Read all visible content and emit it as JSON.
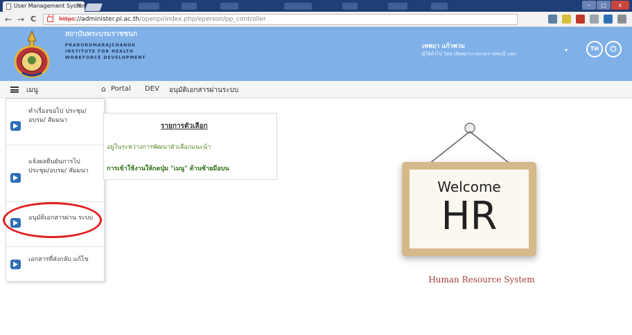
{
  "browser": {
    "tab_title": "User Management System",
    "tab_close": "×",
    "nav_back": "←",
    "nav_forward": "→",
    "nav_reload": "C",
    "url_scheme": "https",
    "url_host": "://administer.pi.ac.th",
    "url_path": "/openpi/index.php/eperson/pp_controller",
    "window_min": "–",
    "window_max": "□",
    "window_close": "x",
    "ext_colors": [
      "#5a7fa0",
      "#d8c03a",
      "#c0392b",
      "#9aa3ad",
      "#2f6fb3",
      "#8a8f96"
    ]
  },
  "header": {
    "org_name": "สถาบันพระบรมราชชนก",
    "org_sub": [
      "PRABOROMARAJCHANOK",
      "INSTITUTE FOR HEALTH",
      "WORKFORCE DEVELOPMENT"
    ],
    "user_name": "เทพฤา แก้วพวม",
    "user_org": "ผู้ใช้ทั่วไป วิทยาลัยพยาบาลบรมราชชนนี แพร่",
    "user_caret": "▾",
    "lang_btn": "TH",
    "power_btn": "⏻",
    "bg_color": "#7fb0e8"
  },
  "menubar": {
    "menu_label": "เมนู",
    "home_icon": "⌂",
    "portal_label": "Portal",
    "dev_label": "DEV",
    "approve_label": "อนุมัติเอกสารผ่านระบบ"
  },
  "sidemenu": {
    "items": [
      {
        "label": "ทำเรื่องขอไป ประชุม/อบรม/ สัมมนา"
      },
      {
        "label": "แจ้งผลยืนยันการไป ประชุม/อบรม/ สัมมนา"
      },
      {
        "label": "อนุมัติเอกสารผ่าน ระบบ"
      },
      {
        "label": "เอกสารที่ส่งกลับ แก้ไข"
      }
    ]
  },
  "list_box": {
    "title": "รายการตัวเลือก",
    "line1": "อยู่ในระหว่างการพัฒนาตัวเลือกแนะนำ",
    "line2": "การเข้าใช้งานให้กดปุ่ม \"เมนู\" ด้านซ้ายมือบน"
  },
  "sign": {
    "small_text": "Welcome",
    "big_text": "HR",
    "caption": "Human Resource System"
  }
}
